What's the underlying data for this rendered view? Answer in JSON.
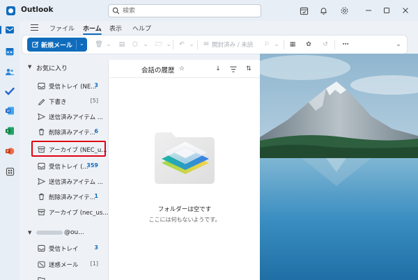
{
  "app": {
    "name": "Outlook",
    "search_placeholder": "検索"
  },
  "ribbon": {
    "tabs": [
      "ファイル",
      "ホーム",
      "表示",
      "ヘルプ"
    ],
    "active_tab": "ホーム",
    "new_mail_label": "新規メール",
    "read_unread_label": "開封済み / 未読"
  },
  "folders": {
    "section_title": "お気に入り",
    "items": [
      {
        "name": "受信トレイ (NE...",
        "count": "3"
      },
      {
        "name": "下書き",
        "count": "[5]"
      },
      {
        "name": "送信済みアイテム ...",
        "count": ""
      },
      {
        "name": "削除済みアイテ...",
        "count": "6"
      },
      {
        "name": "アーカイブ (NEC_u...",
        "count": ""
      },
      {
        "name": "受信トレイ (...",
        "count": "359"
      },
      {
        "name": "送信済みアイテム ...",
        "count": ""
      },
      {
        "name": "削除済みアイテ...",
        "count": "1"
      },
      {
        "name": "アーカイブ (nec_us...",
        "count": ""
      }
    ],
    "account_label": "@ou...",
    "account_items": [
      {
        "name": "受信トレイ",
        "count": "3"
      },
      {
        "name": "迷惑メール",
        "count": "[1]"
      }
    ]
  },
  "message_list": {
    "title": "会話の履歴",
    "empty_title": "フォルダーは空です",
    "empty_subtitle": "ここには何もないようです。"
  },
  "colors": {
    "accent": "#0f6cbd",
    "highlight": "#e00012"
  }
}
